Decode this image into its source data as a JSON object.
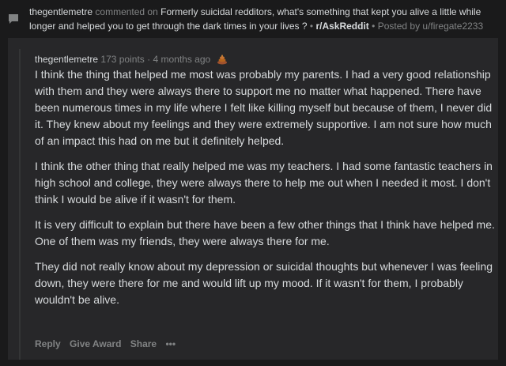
{
  "header": {
    "commenter": "thegentlemetre",
    "commented_on": "commented on",
    "post_title": "Formerly suicidal redditors, what's something that kept you alive a little while longer and helped you to get through the dark times in your lives ?",
    "separator": "•",
    "subreddit": "r/AskReddit",
    "posted_by": "Posted by u/firegate2233"
  },
  "comment": {
    "author": "thegentlemetre",
    "points": "173 points",
    "meta_sep": "·",
    "age": "4 months ago",
    "award_icon": "award-icon",
    "paragraphs": [
      "I think the thing that helped me most was probably my parents. I had a very good relationship with them and they were always there to support me no matter what happened. There have been numerous times in my life where I felt like killing myself but because of them, I never did it. They knew about my feelings and they were extremely supportive. I am not sure how much of an impact this had on me but it definitely helped.",
      "I think the other thing that really helped me was my teachers. I had some fantastic teachers in high school and college, they were always there to help me out when I needed it most. I don't think I would be alive if it wasn't for them.",
      "It is very difficult to explain but there have been a few other things that I think have helped me. One of them was my friends, they were always there for me.",
      "They did not really know about my depression or suicidal thoughts but whenever I was feeling down, they were there for me and would lift up my mood. If it wasn't for them, I probably wouldn't be alive."
    ],
    "actions": {
      "reply": "Reply",
      "give_award": "Give Award",
      "share": "Share",
      "more": "•••"
    }
  },
  "colors": {
    "background": "#1a1a1b",
    "card": "#272729",
    "text": "#d7dadc",
    "muted": "#818384"
  }
}
